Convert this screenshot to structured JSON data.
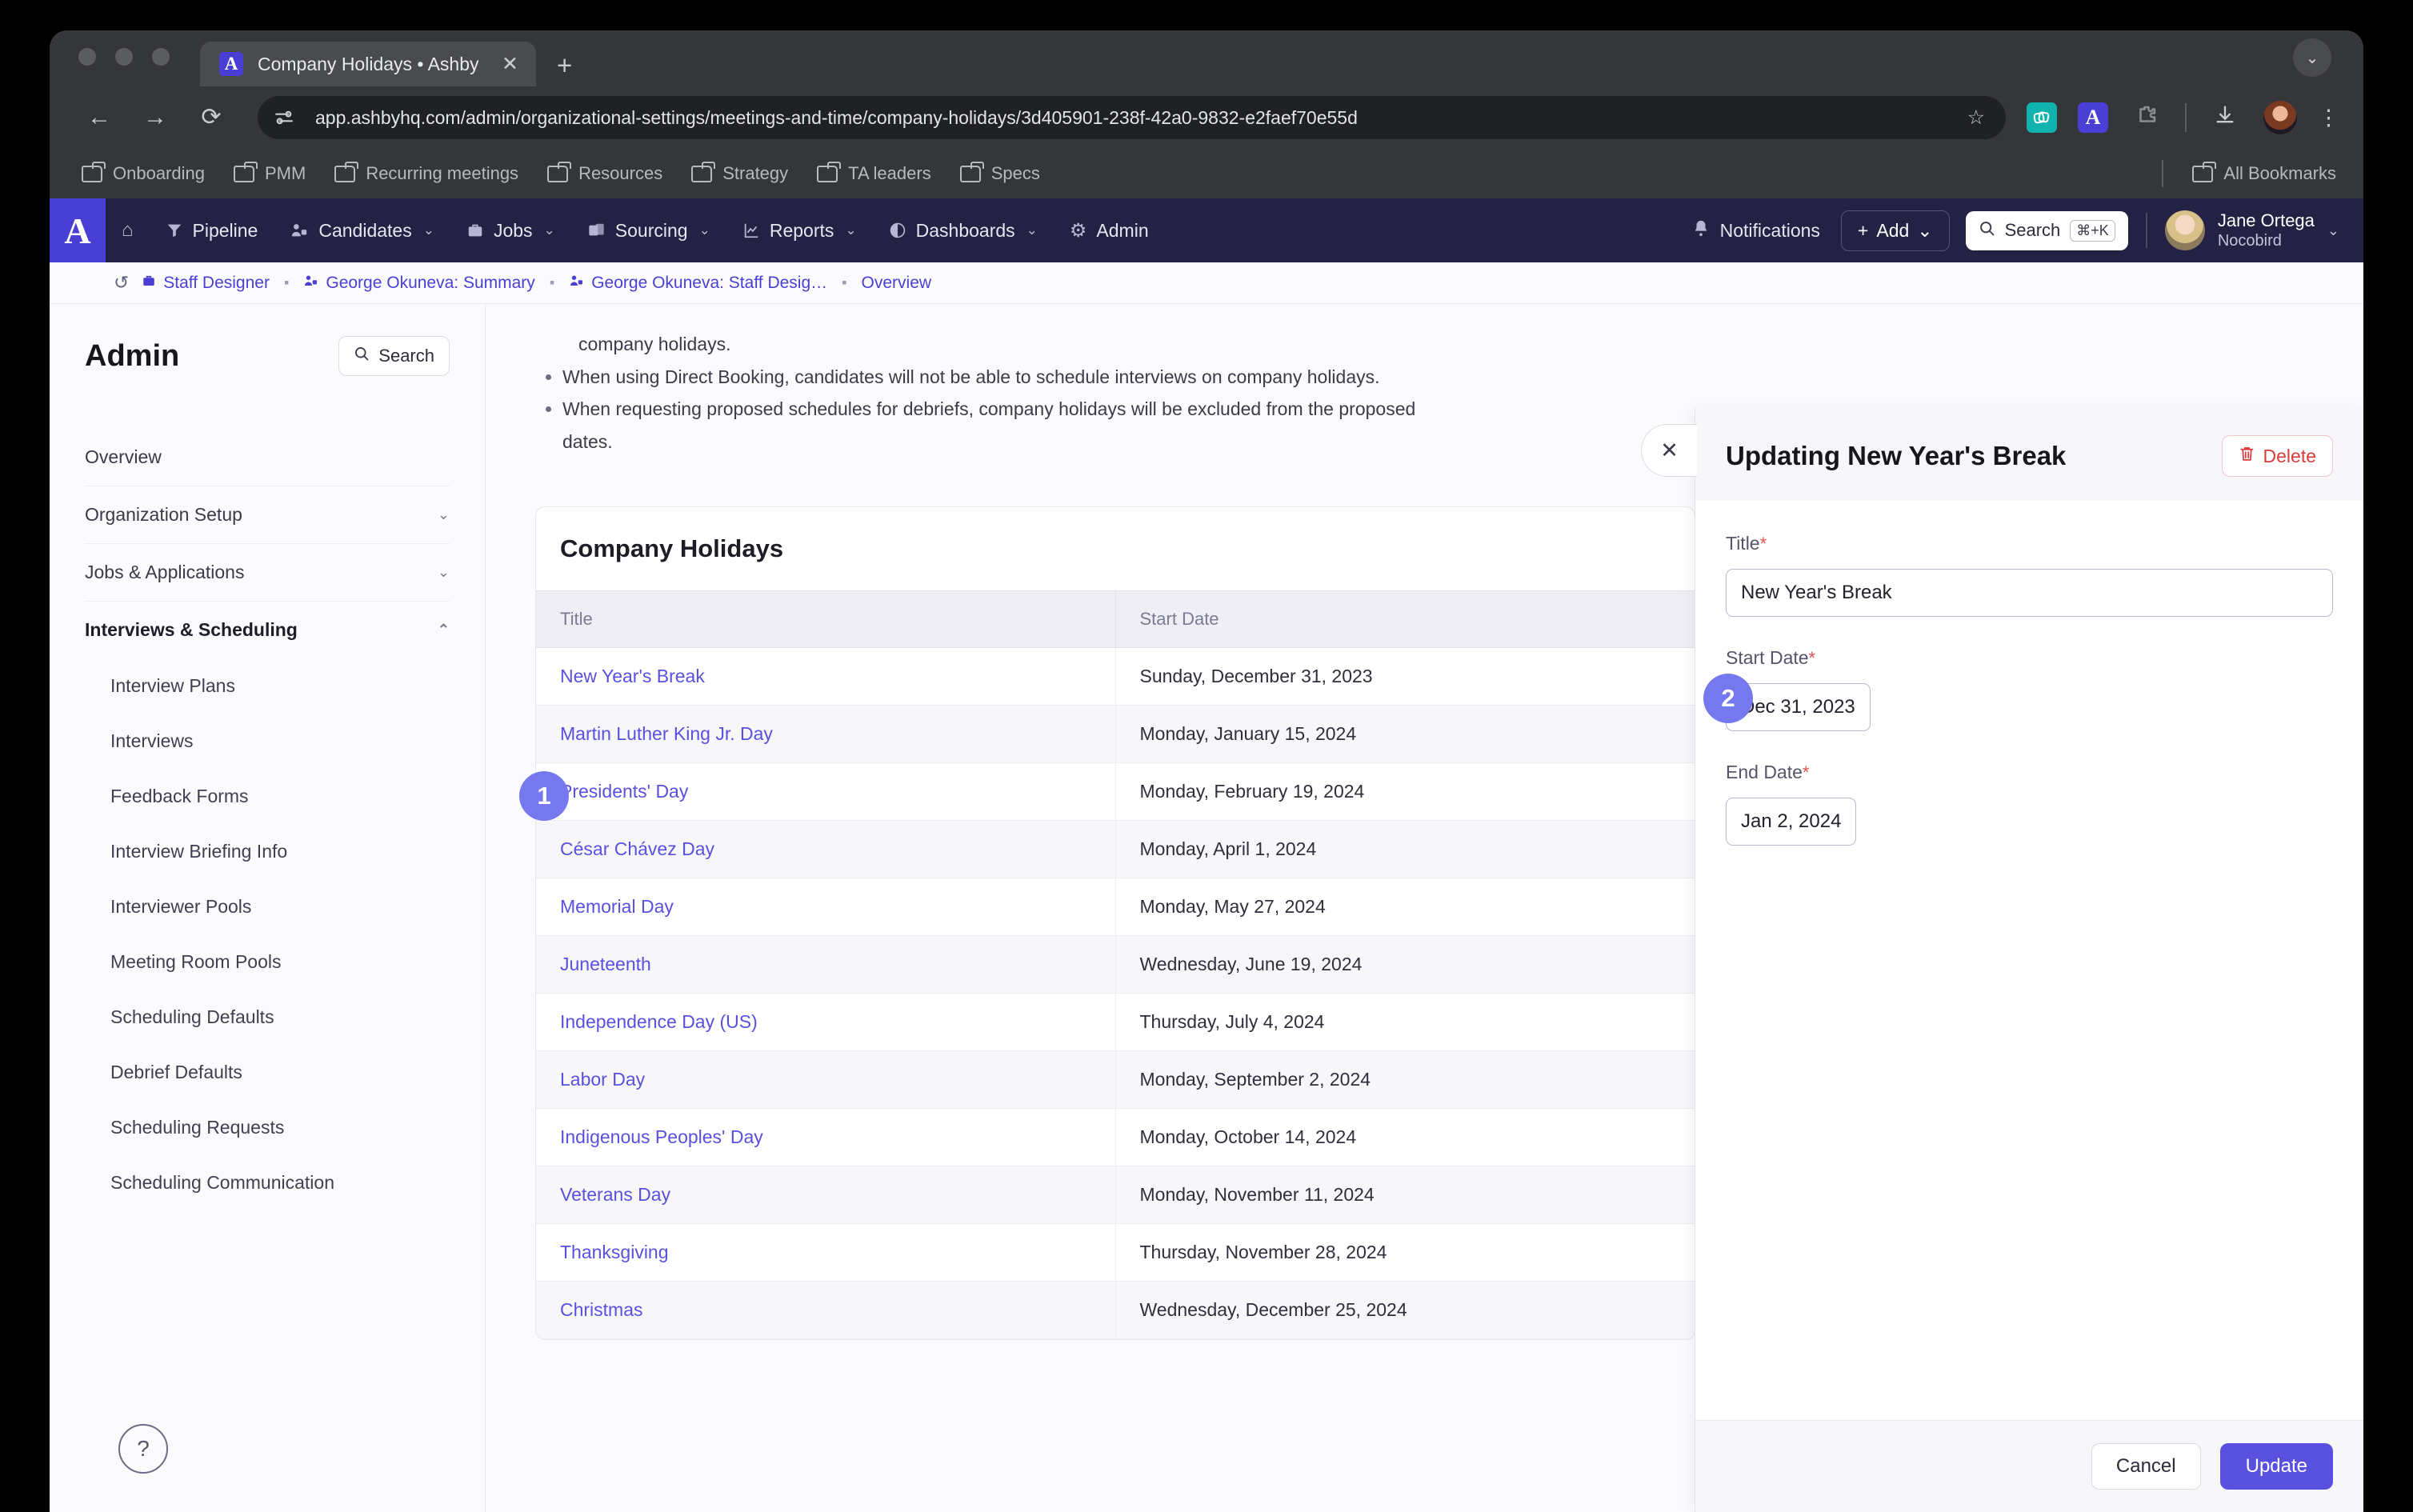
{
  "browser": {
    "tab": {
      "title": "Company Holidays • Ashby",
      "favicon_letter": "A",
      "close_icon": "✕"
    },
    "new_tab_icon": "+",
    "tabstrip_chevron": "⌄",
    "nav": {
      "back_icon": "←",
      "forward_icon": "→",
      "reload_icon": "⟳"
    },
    "url": "app.ashbyhq.com/admin/organizational-settings/meetings-and-time/company-holidays/3d405901-238f-42a0-9832-e2faef70e55d",
    "star_icon": "☆",
    "extension_ashby_letter": "A",
    "kebab_icon": "⋮",
    "bookmarks": [
      "Onboarding",
      "PMM",
      "Recurring meetings",
      "Resources",
      "Strategy",
      "TA leaders",
      "Specs"
    ],
    "all_bookmarks_label": "All Bookmarks"
  },
  "app_nav": {
    "logo_letter": "A",
    "home_icon": "⌂",
    "items": [
      {
        "label": "Pipeline",
        "icon": "▼",
        "caret": ""
      },
      {
        "label": "Candidates",
        "icon": "👤",
        "caret": "⌄"
      },
      {
        "label": "Jobs",
        "icon": "💼",
        "caret": "⌄"
      },
      {
        "label": "Sourcing",
        "icon": "🗂",
        "caret": "⌄"
      },
      {
        "label": "Reports",
        "icon": "📈",
        "caret": "⌄"
      },
      {
        "label": "Dashboards",
        "icon": "◑",
        "caret": "⌄"
      },
      {
        "label": "Admin",
        "icon": "⚙",
        "caret": ""
      }
    ],
    "notifications": {
      "label": "Notifications",
      "icon": "🔔"
    },
    "add": {
      "label": "Add",
      "icon": "+",
      "caret": "⌄"
    },
    "search": {
      "label": "Search",
      "icon": "🔍",
      "shortcut": "⌘+K"
    },
    "user": {
      "name": "Jane Ortega",
      "org": "Nocobird",
      "caret": "⌄"
    }
  },
  "breadcrumb": {
    "history_icon": "↺",
    "items": [
      {
        "label": "Staff Designer",
        "icon": "💼"
      },
      {
        "label": "George Okuneva: Summary",
        "icon": "👥"
      },
      {
        "label": "George Okuneva: Staff Desig…",
        "icon": "👥"
      },
      {
        "label": "Overview",
        "icon": ""
      }
    ],
    "separator": "▪"
  },
  "sidebar": {
    "title": "Admin",
    "search_label": "Search",
    "search_icon": "🔍",
    "groups": [
      {
        "label": "Overview",
        "chevron": "",
        "active": false
      },
      {
        "label": "Organization Setup",
        "chevron": "⌄",
        "active": false
      },
      {
        "label": "Jobs & Applications",
        "chevron": "⌄",
        "active": false
      },
      {
        "label": "Interviews & Scheduling",
        "chevron": "⌃",
        "active": true
      }
    ],
    "sub_items": [
      "Interview Plans",
      "Interviews",
      "Feedback Forms",
      "Interview Briefing Info",
      "Interviewer Pools",
      "Meeting Room Pools",
      "Scheduling Defaults",
      "Debrief Defaults",
      "Scheduling Requests",
      "Scheduling Communication"
    ],
    "help_icon": "?"
  },
  "main": {
    "continued_text": "company holidays.",
    "bullets": [
      "When using Direct Booking, candidates will not be able to schedule interviews on company holidays.",
      "When requesting proposed schedules for debriefs, company holidays will be excluded from the proposed dates."
    ],
    "card_title": "Company Holidays",
    "table": {
      "columns": [
        "Title",
        "Start Date"
      ],
      "rows": [
        {
          "title": "New Year's Break",
          "start_date": "Sunday, December 31, 2023"
        },
        {
          "title": "Martin Luther King Jr. Day",
          "start_date": "Monday, January 15, 2024"
        },
        {
          "title": "Presidents' Day",
          "start_date": "Monday, February 19, 2024"
        },
        {
          "title": "César Chávez Day",
          "start_date": "Monday, April 1, 2024"
        },
        {
          "title": "Memorial Day",
          "start_date": "Monday, May 27, 2024"
        },
        {
          "title": "Juneteenth",
          "start_date": "Wednesday, June 19, 2024"
        },
        {
          "title": "Independence Day (US)",
          "start_date": "Thursday, July 4, 2024"
        },
        {
          "title": "Labor Day",
          "start_date": "Monday, September 2, 2024"
        },
        {
          "title": "Indigenous Peoples' Day",
          "start_date": "Monday, October 14, 2024"
        },
        {
          "title": "Veterans Day",
          "start_date": "Monday, November 11, 2024"
        },
        {
          "title": "Thanksgiving",
          "start_date": "Thursday, November 28, 2024"
        },
        {
          "title": "Christmas",
          "start_date": "Wednesday, December 25, 2024"
        }
      ]
    }
  },
  "drawer": {
    "title": "Updating New Year's Break",
    "delete_label": "Delete",
    "delete_icon": "🗑",
    "close_icon": "✕",
    "fields": {
      "title_label": "Title",
      "title_value": "New Year's Break",
      "start_label": "Start Date",
      "start_value": "Dec 31, 2023",
      "end_label": "End Date",
      "end_value": "Jan 2, 2024",
      "required_marker": "*"
    },
    "cancel_label": "Cancel",
    "update_label": "Update"
  },
  "annotations": [
    {
      "number": "1"
    },
    {
      "number": "2"
    }
  ],
  "colors": {
    "brand_purple": "#4a3fd4",
    "link_purple": "#5a50e0",
    "badge_purple": "#7578ee",
    "nav_dark": "#232244",
    "delete_red": "#d93a3a"
  }
}
